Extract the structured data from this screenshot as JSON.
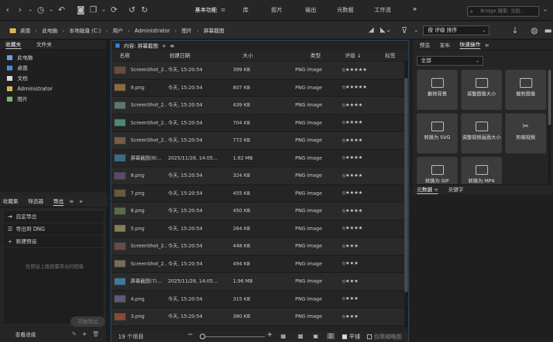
{
  "toolbar": {
    "icons": [
      "chevron-left",
      "chevron-right",
      "chevron-down",
      "history",
      "chevron-down",
      "return",
      "camera",
      "copy",
      "chevron-down",
      "refresh",
      "rotate-left",
      "rotate-right"
    ]
  },
  "workspaces": [
    {
      "label": "基本功能",
      "active": true,
      "menu": "≡"
    },
    {
      "label": "库",
      "active": false
    },
    {
      "label": "胶片",
      "active": false
    },
    {
      "label": "输出",
      "active": false
    },
    {
      "label": "元数据",
      "active": false
    },
    {
      "label": "工作流",
      "active": false
    }
  ],
  "more_glyph": "»",
  "search": {
    "placeholder": "Bridge 搜索: 当前..."
  },
  "path": [
    "桌面",
    "此电脑",
    "本地磁盘 (C:)",
    "用户",
    "Administrator",
    "图片",
    "屏幕截图"
  ],
  "sort": {
    "label": "按 评级 排序"
  },
  "left_panel": {
    "tabs": [
      {
        "label": "收藏夹",
        "active": true
      },
      {
        "label": "文件夹",
        "active": false
      }
    ],
    "favorites": [
      {
        "label": "此电脑",
        "icon": "pc-icon",
        "color": "#6aa0d8"
      },
      {
        "label": "桌面",
        "icon": "desktop-icon",
        "color": "#3f8fd8"
      },
      {
        "label": "文档",
        "icon": "document-icon",
        "color": "#d8d8d8"
      },
      {
        "label": "Administrator",
        "icon": "user-folder-icon",
        "color": "#d8b455"
      },
      {
        "label": "图片",
        "icon": "pictures-icon",
        "color": "#7ab86a"
      }
    ],
    "lower_tabs": [
      {
        "label": "收藏集",
        "active": false
      },
      {
        "label": "筛选器",
        "active": false
      },
      {
        "label": "导出",
        "active": true
      }
    ],
    "export_items": [
      {
        "label": "自定导出",
        "icon": "export-icon"
      },
      {
        "label": "导出到 DNG",
        "icon": "list-icon"
      },
      {
        "label": "新建预设",
        "icon": "plus-icon"
      }
    ],
    "export_hint": "在预设上拖放要导出的图像",
    "start_button": "开始导出",
    "progress_link": "查看进度"
  },
  "content": {
    "title": "内容: 屏幕截图",
    "columns": {
      "name": "名称",
      "date": "创建日期",
      "size": "大小",
      "type": "类型",
      "rating": "评级",
      "tag": "标签"
    },
    "rows": [
      {
        "name": "ScreenShot_2...",
        "date": "今天, 15:20:54",
        "size": "399 KB",
        "type": "PNG image",
        "stars": "★★★★★",
        "thumb": "#6b4a38"
      },
      {
        "name": "9.png",
        "date": "今天, 15:20:54",
        "size": "807 KB",
        "type": "PNG image",
        "stars": "★★★★★",
        "thumb": "#8a6a3e"
      },
      {
        "name": "ScreenShot_2...",
        "date": "今天, 15:20:54",
        "size": "439 KB",
        "type": "PNG image",
        "stars": "★★★★",
        "thumb": "#5a7a6a"
      },
      {
        "name": "ScreenShot_2...",
        "date": "今天, 15:20:54",
        "size": "704 KB",
        "type": "PNG image",
        "stars": "★★★★",
        "thumb": "#4a8a7a"
      },
      {
        "name": "ScreenShot_2...",
        "date": "今天, 15:20:54",
        "size": "772 KB",
        "type": "PNG image",
        "stars": "★★★★",
        "thumb": "#7a5a4a"
      },
      {
        "name": "屏幕截图(8)...",
        "date": "2025/11/28, 14:05...",
        "size": "1.82 MB",
        "type": "PNG image",
        "stars": "★★★★",
        "thumb": "#3a6a8a"
      },
      {
        "name": "8.png",
        "date": "今天, 15:20:54",
        "size": "324 KB",
        "type": "PNG image",
        "stars": "★★★★",
        "thumb": "#5a4a6a"
      },
      {
        "name": "7.png",
        "date": "今天, 15:20:54",
        "size": "455 KB",
        "type": "PNG image",
        "stars": "★★★★",
        "thumb": "#6a5a3a"
      },
      {
        "name": "6.png",
        "date": "今天, 15:20:54",
        "size": "450 KB",
        "type": "PNG image",
        "stars": "★★★★",
        "thumb": "#5a6a4a"
      },
      {
        "name": "5.png",
        "date": "今天, 15:20:54",
        "size": "264 KB",
        "type": "PNG image",
        "stars": "★★★★",
        "thumb": "#8a7a5a"
      },
      {
        "name": "ScreenShot_2...",
        "date": "今天, 15:20:54",
        "size": "448 KB",
        "type": "PNG image",
        "stars": "★★★",
        "thumb": "#6a4a4a"
      },
      {
        "name": "ScreenShot_2...",
        "date": "今天, 15:20:54",
        "size": "494 KB",
        "type": "PNG image",
        "stars": "★★★",
        "thumb": "#7a6a5a"
      },
      {
        "name": "屏幕截图(7)...",
        "date": "2025/11/28, 14:05...",
        "size": "1.96 MB",
        "type": "PNG image",
        "stars": "★★★",
        "thumb": "#3a7a9a"
      },
      {
        "name": "4.png",
        "date": "今天, 15:20:54",
        "size": "315 KB",
        "type": "PNG image",
        "stars": "★★★",
        "thumb": "#5a5a7a"
      },
      {
        "name": "3.png",
        "date": "今天, 15:20:54",
        "size": "380 KB",
        "type": "PNG image",
        "stars": "★★★",
        "thumb": "#8a4a3a"
      }
    ],
    "footer": {
      "count": "19 个项目",
      "tile": "平铺",
      "lock": "仅限缩略图"
    }
  },
  "right_panel": {
    "tabs": [
      {
        "label": "预览",
        "active": false
      },
      {
        "label": "发布",
        "active": false
      },
      {
        "label": "快速操作",
        "active": true
      }
    ],
    "filter": "全部",
    "quick_actions": [
      {
        "label": "删除背景",
        "icon": "image-icon"
      },
      {
        "label": "调整图像大小",
        "icon": "image-resize-icon"
      },
      {
        "label": "裁剪图像",
        "icon": "crop-icon"
      },
      {
        "label": "转换为 SVG",
        "icon": "svg-icon"
      },
      {
        "label": "调整视频画面大小",
        "icon": "video-resize-icon"
      },
      {
        "label": "剪辑视频",
        "icon": "scissors-icon"
      },
      {
        "label": "转换为 GIF",
        "icon": "gif-icon"
      },
      {
        "label": "转换为 MP4",
        "icon": "mp4-icon"
      }
    ],
    "meta_tabs": [
      {
        "label": "元数据",
        "active": true
      },
      {
        "label": "关键字",
        "active": false
      }
    ]
  },
  "colors": {
    "accent": "#3a7fd6",
    "folder": "#d8b455",
    "background": "#1e1e1e"
  }
}
